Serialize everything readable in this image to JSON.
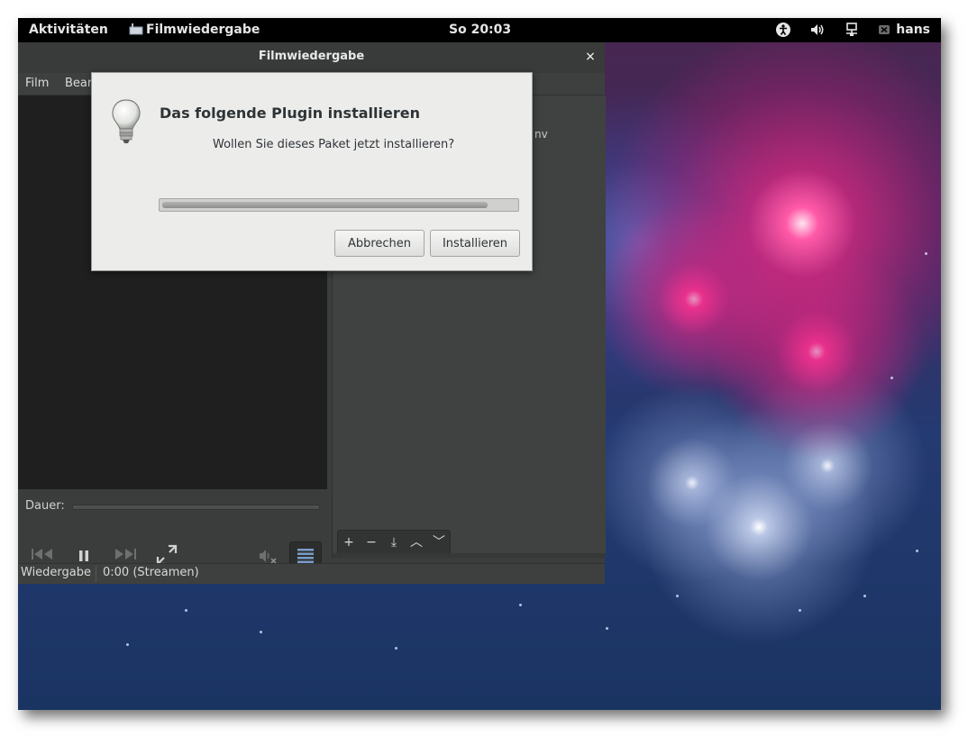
{
  "topbar": {
    "activities": "Aktivitäten",
    "app_name": "Filmwiedergabe",
    "clock": "So 20:03",
    "user": "hans"
  },
  "player": {
    "title": "Filmwiedergabe",
    "close_symbol": "×",
    "menu": [
      "Film",
      "Bear"
    ],
    "sidebar_snippet": "nv",
    "duration_label": "Dauer:",
    "seek_progress": 0,
    "sidebar_toolbar": [
      "+",
      "−",
      "⤓",
      "︿",
      "﹀"
    ],
    "status_left": "Wiedergabe",
    "status_right": "0:00 (Streamen)"
  },
  "dialog": {
    "heading": "Das folgende Plugin installieren",
    "message": "Wollen Sie dieses Paket jetzt installieren?",
    "progress_fraction": 0.92,
    "cancel_label": "Abbrechen",
    "install_label": "Installieren"
  },
  "icons": {
    "bulb": "light-bulb-icon",
    "accessibility": "accessibility-icon",
    "volume": "volume-icon",
    "network": "network-icon",
    "user": "user-icon"
  }
}
